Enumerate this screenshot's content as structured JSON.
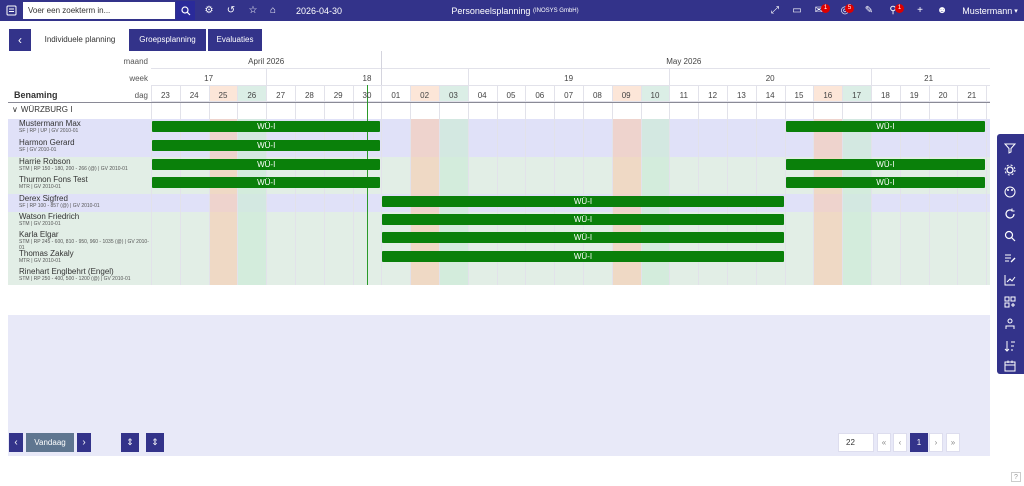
{
  "topbar": {
    "search_placeholder": "Voer een zoekterm in...",
    "date": "2026-04-30",
    "app_title": "Personeelsplanning",
    "company": "(INOSYS GmbH)",
    "user": "Mustermann",
    "badges": [
      "1",
      "5",
      "1"
    ]
  },
  "tabs": {
    "back": "‹",
    "individual": "Individuele planning",
    "group": "Groepsplanning",
    "evaluations": "Evaluaties"
  },
  "header": {
    "month_label": "maand",
    "week_label": "week",
    "day_label": "dag",
    "name_col": "Benaming",
    "months": [
      "April 2026",
      "May 2026"
    ],
    "weeks": [
      "17",
      "18",
      "19",
      "20",
      "21"
    ],
    "days": [
      "23",
      "24",
      "25",
      "26",
      "27",
      "28",
      "29",
      "30",
      "01",
      "02",
      "03",
      "04",
      "05",
      "06",
      "07",
      "08",
      "09",
      "10",
      "11",
      "12",
      "13",
      "14",
      "15",
      "16",
      "17",
      "18",
      "19",
      "20",
      "21"
    ]
  },
  "group": {
    "name": "WÜRZBURG I",
    "toggle": "∨"
  },
  "employees": [
    {
      "name": "Mustermann Max",
      "detail": "SF | RP | UP | GV 2010-01"
    },
    {
      "name": "Harmon Gerard",
      "detail": "SF | GV 2010-01"
    },
    {
      "name": "Harrie Robson",
      "detail": "STM | RP 150 - 180, 200 - 266 (@) | GV 2010-01"
    },
    {
      "name": "Thurmon Fons Test",
      "detail": "MTR | GV 2010-01"
    },
    {
      "name": "Derex Sigfred",
      "detail": "SF | RP 100 - 857 (@) | GV 2010-01"
    },
    {
      "name": "Watson Friedrich",
      "detail": "STM | GV 2010-01"
    },
    {
      "name": "Karla Elgar",
      "detail": "STM | RP 245 - 600, 810 - 950, 960 - 1035 (@) | GV 2010-01"
    },
    {
      "name": "Thomas Zakaly",
      "detail": "MTR | GV 2010-01"
    },
    {
      "name": "Rinehart Englbehrt (Engel)",
      "detail": "STM | RP 250 - 400, 500 - 1200 (@) | GV 2010-01"
    }
  ],
  "bar_label": "WÜ-I",
  "footer": {
    "prev": "‹",
    "today": "Vandaag",
    "next": "›",
    "expand": "⇕",
    "collapse": "⇕",
    "page_size": "22",
    "first": "«",
    "prev_page": "‹",
    "current_page": "1",
    "next_page": "›",
    "last": "»"
  },
  "help": "?",
  "colors": {
    "accent": "#33338a",
    "bar": "#0a800a",
    "weekend": "#f7dccb",
    "holiday": "#dcefe8"
  }
}
